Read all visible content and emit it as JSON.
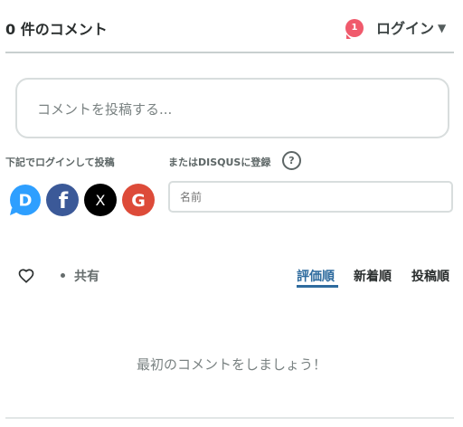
{
  "header": {
    "comment_count": "0 件のコメント",
    "notification_count": "1",
    "login_label": "ログイン",
    "caret": "▼"
  },
  "composer": {
    "placeholder": "コメントを投稿する..."
  },
  "auth": {
    "social_login_label": "下記でログインして投稿",
    "register_label": "またはDISQUSに登録",
    "help_glyph": "?",
    "name_placeholder": "名前",
    "providers": [
      "Disqus",
      "Facebook",
      "X",
      "Google"
    ],
    "provider_letters": {
      "disqus": "D",
      "facebook": "f",
      "x": "X",
      "google": "G"
    }
  },
  "toolbar": {
    "share_label": "共有",
    "sort_tabs": [
      "評価順",
      "新着順",
      "投稿順"
    ],
    "active_sort": "評価順"
  },
  "empty_state": {
    "message": "最初のコメントをしましょう！"
  },
  "colors": {
    "badge": "#f05a6c",
    "active_tab": "#2e6b9e",
    "disqus": "#2e9fff",
    "facebook": "#3b5998",
    "x": "#000000",
    "google": "#dd4b39"
  }
}
